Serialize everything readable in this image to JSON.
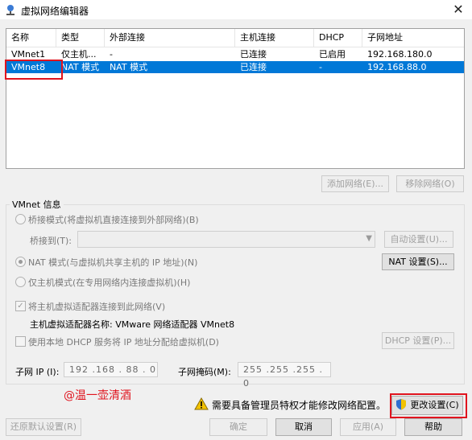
{
  "window": {
    "title": "虚拟网络编辑器",
    "close_glyph": "✕"
  },
  "table": {
    "columns": [
      "名称",
      "类型",
      "外部连接",
      "主机连接",
      "DHCP",
      "子网地址"
    ],
    "rows": [
      [
        "VMnet1",
        "仅主机...",
        "-",
        "已连接",
        "已启用",
        "192.168.180.0"
      ],
      [
        "VMnet8",
        "NAT 模式",
        "NAT 模式",
        "已连接",
        "-",
        "192.168.88.0"
      ]
    ],
    "selected_row": 1
  },
  "buttons": {
    "add_network": "添加网络(E)...",
    "remove_network": "移除网络(O)",
    "auto_settings": "自动设置(U)...",
    "nat_settings": "NAT 设置(S)...",
    "dhcp_settings": "DHCP 设置(P)...",
    "change_settings": "更改设置(C)",
    "restore_defaults": "还原默认设置(R)",
    "ok": "确定",
    "cancel": "取消",
    "apply": "应用(A)",
    "help": "帮助"
  },
  "vmnet_info": {
    "group_title": "VMnet 信息",
    "bridged_label": "桥接模式(将虚拟机直接连接到外部网络)(B)",
    "bridged_to_label": "桥接到(T):",
    "nat_label": "NAT 模式(与虚拟机共享主机的 IP 地址)(N)",
    "hostonly_label": "仅主机模式(在专用网络内连接虚拟机)(H)",
    "connect_adapter_label": "将主机虚拟适配器连接到此网络(V)",
    "adapter_name_label": "主机虚拟适配器名称: VMware 网络适配器 VMnet8",
    "use_dhcp_label": "使用本地 DHCP 服务将 IP 地址分配给虚拟机(D)",
    "subnet_ip_label": "子网 IP (I):",
    "subnet_ip_value": "192 .168 . 88 . 0",
    "subnet_mask_label": "子网掩码(M):",
    "subnet_mask_value": "255 .255 .255 . 0"
  },
  "warning_text": "需要具备管理员特权才能修改网络配置。",
  "watermark": "@温一壶清酒",
  "colors": {
    "selection": "#0078d7",
    "highlight_box": "#e0141e",
    "warning": "#f2c200"
  }
}
